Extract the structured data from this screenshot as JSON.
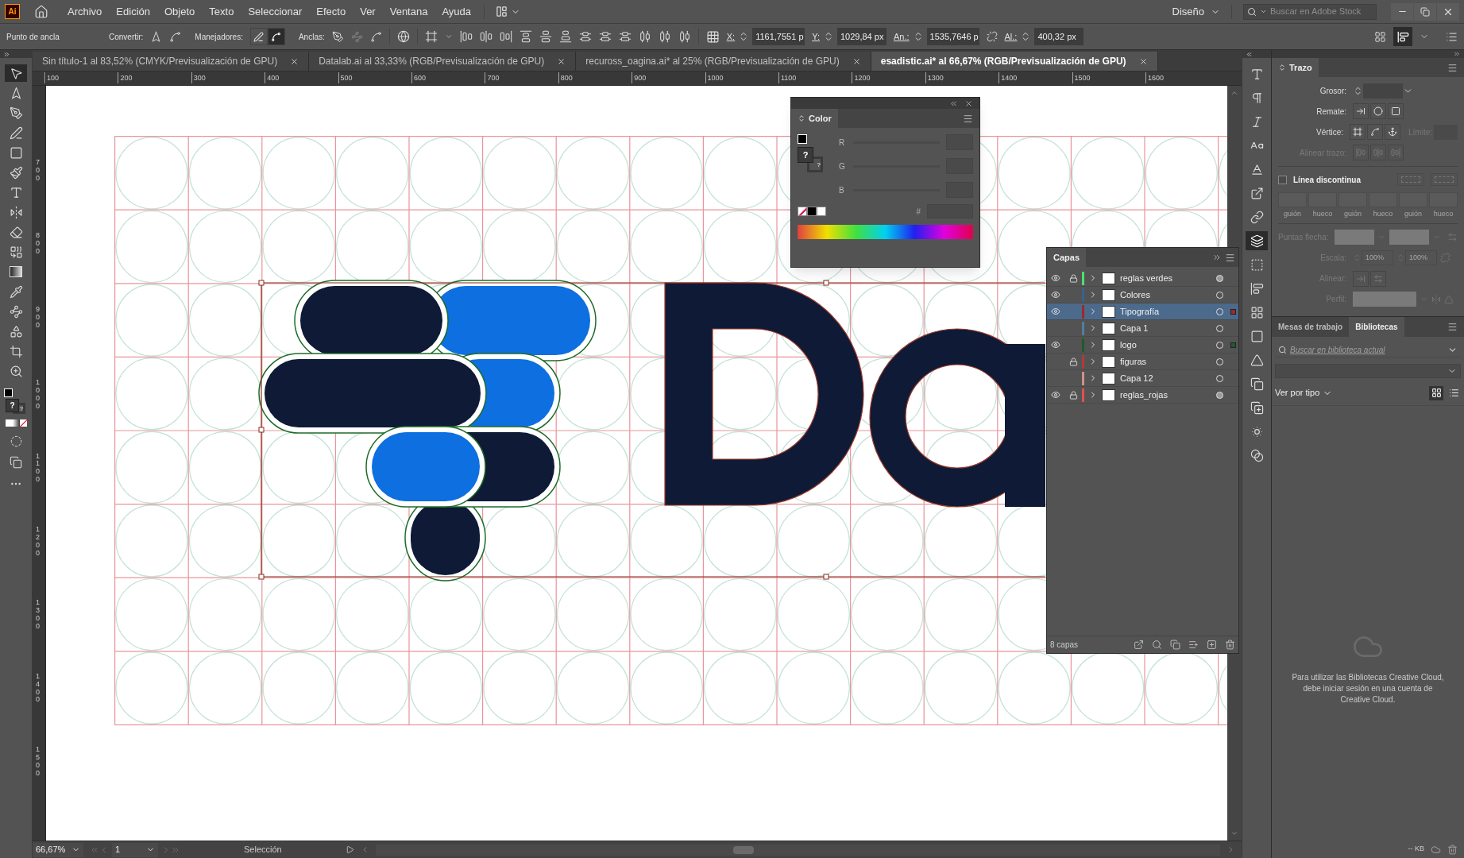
{
  "app_logo": "Ai",
  "menu": [
    "Archivo",
    "Edición",
    "Objeto",
    "Texto",
    "Seleccionar",
    "Efecto",
    "Ver",
    "Ventana",
    "Ayuda"
  ],
  "workspace": "Diseño",
  "stock_search": {
    "placeholder": "Buscar en Adobe Stock"
  },
  "control_bar": {
    "selection_label": "Punto de ancla",
    "convert_label": "Convertir:",
    "handles_label": "Manejadores:",
    "anchors_label": "Anclas:",
    "handle_modes": [
      {
        "kind": "show",
        "selected": false
      },
      {
        "kind": "hide",
        "selected": true
      }
    ],
    "fields": [
      {
        "label": "X:",
        "value": "1161,7551 p"
      },
      {
        "label": "Y:",
        "value": "1029,84 px"
      },
      {
        "label": "An.:",
        "value": "1535,7646 p"
      },
      {
        "label": "Al.:",
        "value": "400,32 px"
      }
    ],
    "view_toggle": {
      "selected": true
    }
  },
  "document_tabs": [
    {
      "label": "Sin título-1 al 83,52% (CMYK/Previsualización de GPU)",
      "selected": false
    },
    {
      "label": "Datalab.ai al 33,33% (RGB/Previsualización de GPU)",
      "selected": false
    },
    {
      "label": "recuross_oagina.ai* al 25% (RGB/Previsualización de GPU)",
      "selected": false
    },
    {
      "label": "esadistic.ai* al 66,67% (RGB/Previsualización de GPU)",
      "selected": true
    }
  ],
  "toolbar": {
    "tools": [
      {
        "kind": "selection",
        "selected": true
      },
      {
        "kind": "direct-selection",
        "selected": false
      },
      {
        "kind": "pen",
        "selected": false
      },
      {
        "kind": "curvature",
        "selected": false
      },
      {
        "kind": "rectangle",
        "selected": false
      },
      {
        "kind": "brush",
        "selected": false
      },
      {
        "kind": "type",
        "selected": false
      },
      {
        "kind": "reflect",
        "selected": false
      },
      {
        "kind": "eraser",
        "selected": false
      },
      {
        "kind": "shape-builder",
        "selected": false
      },
      {
        "kind": "gradient",
        "selected": false
      },
      {
        "kind": "eyedropper",
        "selected": false
      },
      {
        "kind": "blend",
        "selected": false
      },
      {
        "kind": "live-paint",
        "selected": false
      },
      {
        "kind": "artboard",
        "selected": false
      },
      {
        "kind": "zoom",
        "selected": false
      }
    ],
    "fill_indicator": "?",
    "stroke_indicator": "?"
  },
  "rulers": {
    "horizontal": [
      "100",
      "200",
      "300",
      "400",
      "500",
      "600",
      "700",
      "800",
      "900",
      "1000",
      "1100",
      "1200",
      "1300",
      "1400",
      "1500",
      "1600"
    ],
    "vertical": [
      "700",
      "800",
      "900",
      "1000",
      "1100",
      "1200",
      "1300",
      "1400",
      "1500"
    ]
  },
  "color_panel": {
    "title": "Color",
    "fill_indicator": "?",
    "stroke_indicator": "?",
    "channels": [
      "R",
      "G",
      "B"
    ],
    "hex_label": "#"
  },
  "layers_panel": {
    "title": "Capas",
    "layers": [
      {
        "name": "reglas verdes",
        "visible": true,
        "locked": true,
        "color": "#4fdf6f",
        "selected": false,
        "target_filled": true,
        "art_selected": false
      },
      {
        "name": "Colores",
        "visible": true,
        "locked": false,
        "color": "#3a6090",
        "selected": false,
        "target_filled": false,
        "art_selected": false
      },
      {
        "name": "Tipografía",
        "visible": true,
        "locked": false,
        "color": "#a02828",
        "selected": true,
        "target_filled": false,
        "art_selected": true
      },
      {
        "name": "Capa 1",
        "visible": false,
        "locked": false,
        "color": "#4f7fa0",
        "selected": false,
        "target_filled": false,
        "art_selected": false
      },
      {
        "name": "logo",
        "visible": true,
        "locked": false,
        "color": "#1f5a2f",
        "selected": false,
        "target_filled": false,
        "art_selected": true
      },
      {
        "name": "figuras",
        "visible": false,
        "locked": true,
        "color": "#b03a3a",
        "selected": false,
        "target_filled": false,
        "art_selected": false
      },
      {
        "name": "Capa 12",
        "visible": false,
        "locked": false,
        "color": "#d0908a",
        "selected": false,
        "target_filled": false,
        "art_selected": false
      },
      {
        "name": "reglas_rojas",
        "visible": true,
        "locked": true,
        "color": "#e05050",
        "selected": false,
        "target_filled": true,
        "art_selected": false
      }
    ],
    "count": "8 capas"
  },
  "panel_strip": [
    {
      "kind": "character",
      "selected": false
    },
    {
      "kind": "paragraph",
      "selected": false
    },
    {
      "kind": "opentype",
      "selected": false
    },
    {
      "kind": "character-styles",
      "selected": false
    },
    {
      "kind": "paragraph-styles",
      "selected": false
    },
    {
      "kind": "export",
      "selected": false
    },
    {
      "kind": "links",
      "selected": false
    },
    {
      "kind": "layers",
      "selected": true
    },
    {
      "kind": "artboards",
      "selected": false
    },
    {
      "kind": "align",
      "selected": false
    },
    {
      "kind": "swatches",
      "selected": false
    },
    {
      "kind": "gradient",
      "selected": false
    },
    {
      "kind": "transparency",
      "selected": false
    },
    {
      "kind": "pathfinder",
      "selected": false
    },
    {
      "kind": "transform",
      "selected": false
    },
    {
      "kind": "appearance",
      "selected": false
    },
    {
      "kind": "color-guide",
      "selected": false
    }
  ],
  "stroke_panel": {
    "title": "Trazo",
    "rows": [
      {
        "kind": "weight",
        "label": "Grosor:",
        "disabled": false
      },
      {
        "kind": "cap",
        "label": "Remate:",
        "disabled": false
      },
      {
        "kind": "corner",
        "label": "Vértice:",
        "disabled": false,
        "limit": {
          "label": "Límite:",
          "disabled": true
        }
      },
      {
        "kind": "align",
        "label": "Alinear trazo:",
        "disabled": true
      }
    ],
    "dashed": {
      "label": "Línea discontinua",
      "checked": false,
      "slots": [
        "guión",
        "hueco",
        "guión",
        "hueco",
        "guión",
        "hueco"
      ]
    },
    "lower_rows": [
      {
        "kind": "arrowheads",
        "label": "Puntas flecha:",
        "disabled": true
      },
      {
        "kind": "scale",
        "label": "Escala:",
        "disabled": true,
        "values": [
          "100%",
          "100%"
        ]
      },
      {
        "kind": "arrow-align",
        "label": "Alinear:",
        "disabled": true
      },
      {
        "kind": "profile",
        "label": "Perfil:",
        "disabled": true
      }
    ]
  },
  "libraries_panel": {
    "tabs": [
      {
        "label": "Mesas de trabajo",
        "selected": false
      },
      {
        "label": "Bibliotecas",
        "selected": true
      }
    ],
    "search_placeholder": "Buscar en biblioteca actual",
    "view_by": "Ver por tipo",
    "view_modes": [
      {
        "kind": "grid",
        "selected": true
      },
      {
        "kind": "list",
        "selected": false
      }
    ],
    "message": "Para utilizar las Bibliotecas Creative Cloud, debe iniciar sesión en una cuenta de Creative Cloud.",
    "storage": "-- KB"
  },
  "status_bar": {
    "zoom": "66,67%",
    "artboard": "1",
    "tool": "Selección"
  }
}
